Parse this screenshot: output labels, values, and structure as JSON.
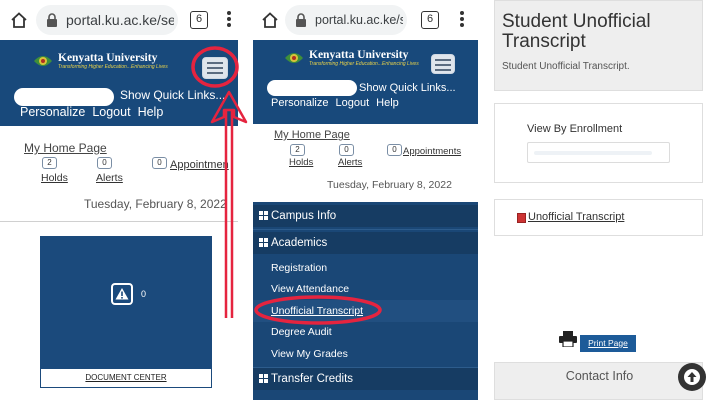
{
  "browser": {
    "url": "portal.ku.ac.ke/sec",
    "tab_count": "6",
    "icons": [
      "home-icon",
      "lock-icon",
      "tab-switcher-icon",
      "overflow-menu-icon"
    ]
  },
  "brand": {
    "name": "Kenyatta University",
    "tagline": "Transforming Higher Education...Enhancing Lives"
  },
  "header": {
    "quick_links": "Show Quick Links...",
    "nav": [
      "Personalize",
      "Logout",
      "Help"
    ]
  },
  "home": {
    "my_home_page": "My Home Page",
    "holds": {
      "count": "2",
      "label": "Holds"
    },
    "alerts": {
      "count": "0",
      "label": "Alerts"
    },
    "appointments": {
      "count": "0",
      "label": "Appointments",
      "label_cut": "Appointmen"
    },
    "date": "Tuesday, February 8, 2022"
  },
  "document_center": {
    "count": "0",
    "label": "DOCUMENT CENTER"
  },
  "menu": {
    "campus_info": "Campus Info",
    "academics": "Academics",
    "items": [
      "Registration",
      "View Attendance",
      "Unofficial Transcript",
      "Degree Audit",
      "View My Grades"
    ],
    "transfer_credits": "Transfer Credits"
  },
  "transcript": {
    "title": "Student Unofficial Transcript",
    "subtitle": "Student Unofficial Transcript.",
    "view_by": "View By Enrollment",
    "link": "Unofficial Transcript",
    "print_button": "Print Page",
    "contact": "Contact Info"
  },
  "colors": {
    "header_blue": "#18497b",
    "menu_blue": "#1a4776",
    "annotation_red": "#e5243f",
    "print_button": "#1d5b99"
  }
}
